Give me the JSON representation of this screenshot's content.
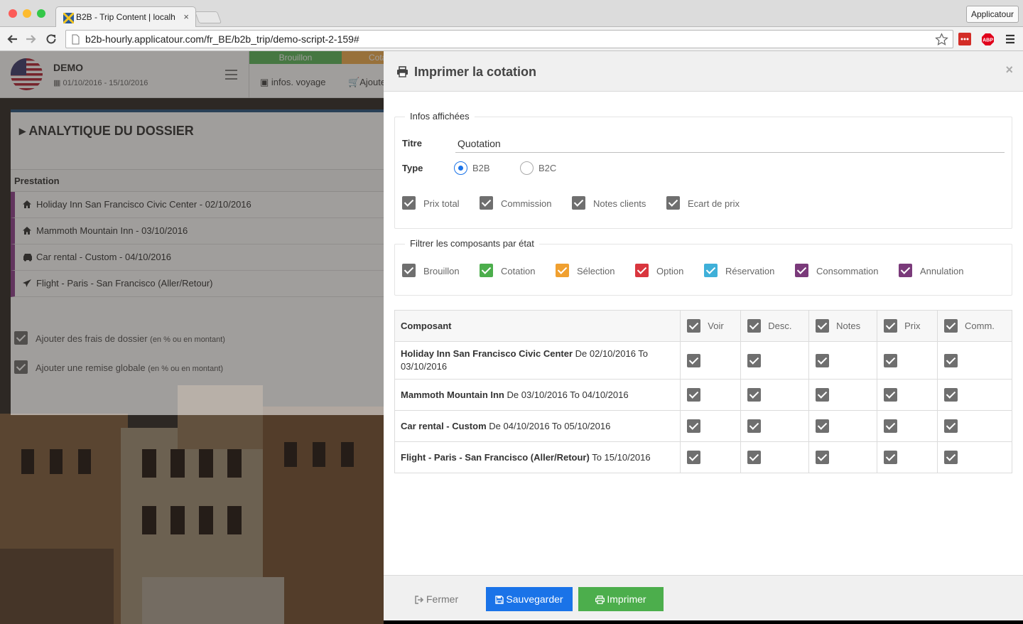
{
  "browser": {
    "tab_title": "B2B - Trip Content | localh",
    "tab_close": "×",
    "profile_label": "Applicatour",
    "url": "b2b-hourly.applicatour.com/fr_BE/b2b_trip/demo-script-2-159#",
    "ext_abp": "ABP"
  },
  "app": {
    "trip_name": "DEMO",
    "trip_dates": "01/10/2016 - 15/10/2016",
    "status_brouillon": "Brouillon",
    "status_cotation": "Cota",
    "nav_infos": "infos. voyage",
    "nav_add": "Ajoute",
    "analytics_title": "ANALYTIQUE DU DOSSIER",
    "prestation_header": "Prestation",
    "prestations": [
      {
        "label": "Holiday Inn San Francisco Civic Center - 02/10/2016",
        "icon": "home-icon"
      },
      {
        "label": "Mammoth Mountain Inn - 03/10/2016",
        "icon": "home-icon"
      },
      {
        "label": "Car rental - Custom - 04/10/2016",
        "icon": "car-icon"
      },
      {
        "label": "Flight - Paris - San Francisco (Aller/Retour)",
        "icon": "plane-icon"
      }
    ],
    "opt_frais": "Ajouter des frais de dossier",
    "opt_frais_note": "(en % ou en montant)",
    "opt_remise": "Ajouter une remise globale",
    "opt_remise_note": "(en % ou en montant)"
  },
  "modal": {
    "title": "Imprimer la cotation",
    "close": "×",
    "infos_legend": "Infos affichées",
    "titre_label": "Titre",
    "titre_value": "Quotation",
    "type_label": "Type",
    "type_b2b": "B2B",
    "type_b2c": "B2C",
    "type_selected": "B2B",
    "info_checks": [
      "Prix total",
      "Commission",
      "Notes clients",
      "Ecart de prix"
    ],
    "filter_legend": "Filtrer les composants par état",
    "filters": [
      {
        "label": "Brouillon",
        "color": "#6f6f6f"
      },
      {
        "label": "Cotation",
        "color": "#4cae4c"
      },
      {
        "label": "Sélection",
        "color": "#f0a030"
      },
      {
        "label": "Option",
        "color": "#d9363e"
      },
      {
        "label": "Réservation",
        "color": "#3fb0d9"
      },
      {
        "label": "Consommation",
        "color": "#7a3a7a"
      },
      {
        "label": "Annulation",
        "color": "#7a3a7a"
      }
    ],
    "table": {
      "col_component": "Composant",
      "columns": [
        "Voir",
        "Desc.",
        "Notes",
        "Prix",
        "Comm."
      ],
      "rows": [
        {
          "name": "Holiday Inn San Francisco Civic Center",
          "dates": "De 02/10/2016 To 03/10/2016"
        },
        {
          "name": "Mammoth Mountain Inn",
          "dates": "De 03/10/2016 To 04/10/2016"
        },
        {
          "name": "Car rental - Custom",
          "dates": "De 04/10/2016 To 05/10/2016"
        },
        {
          "name": "Flight - Paris - San Francisco (Aller/Retour)",
          "dates": "To 15/10/2016"
        }
      ]
    },
    "btn_close": "Fermer",
    "btn_save": "Sauvegarder",
    "btn_print": "Imprimer"
  },
  "colors": {
    "accent_blue": "#1a73e8",
    "success_green": "#4cae4c",
    "checkbox_gray": "#6f6f6f",
    "prestation_border": "#8e3f8e"
  }
}
